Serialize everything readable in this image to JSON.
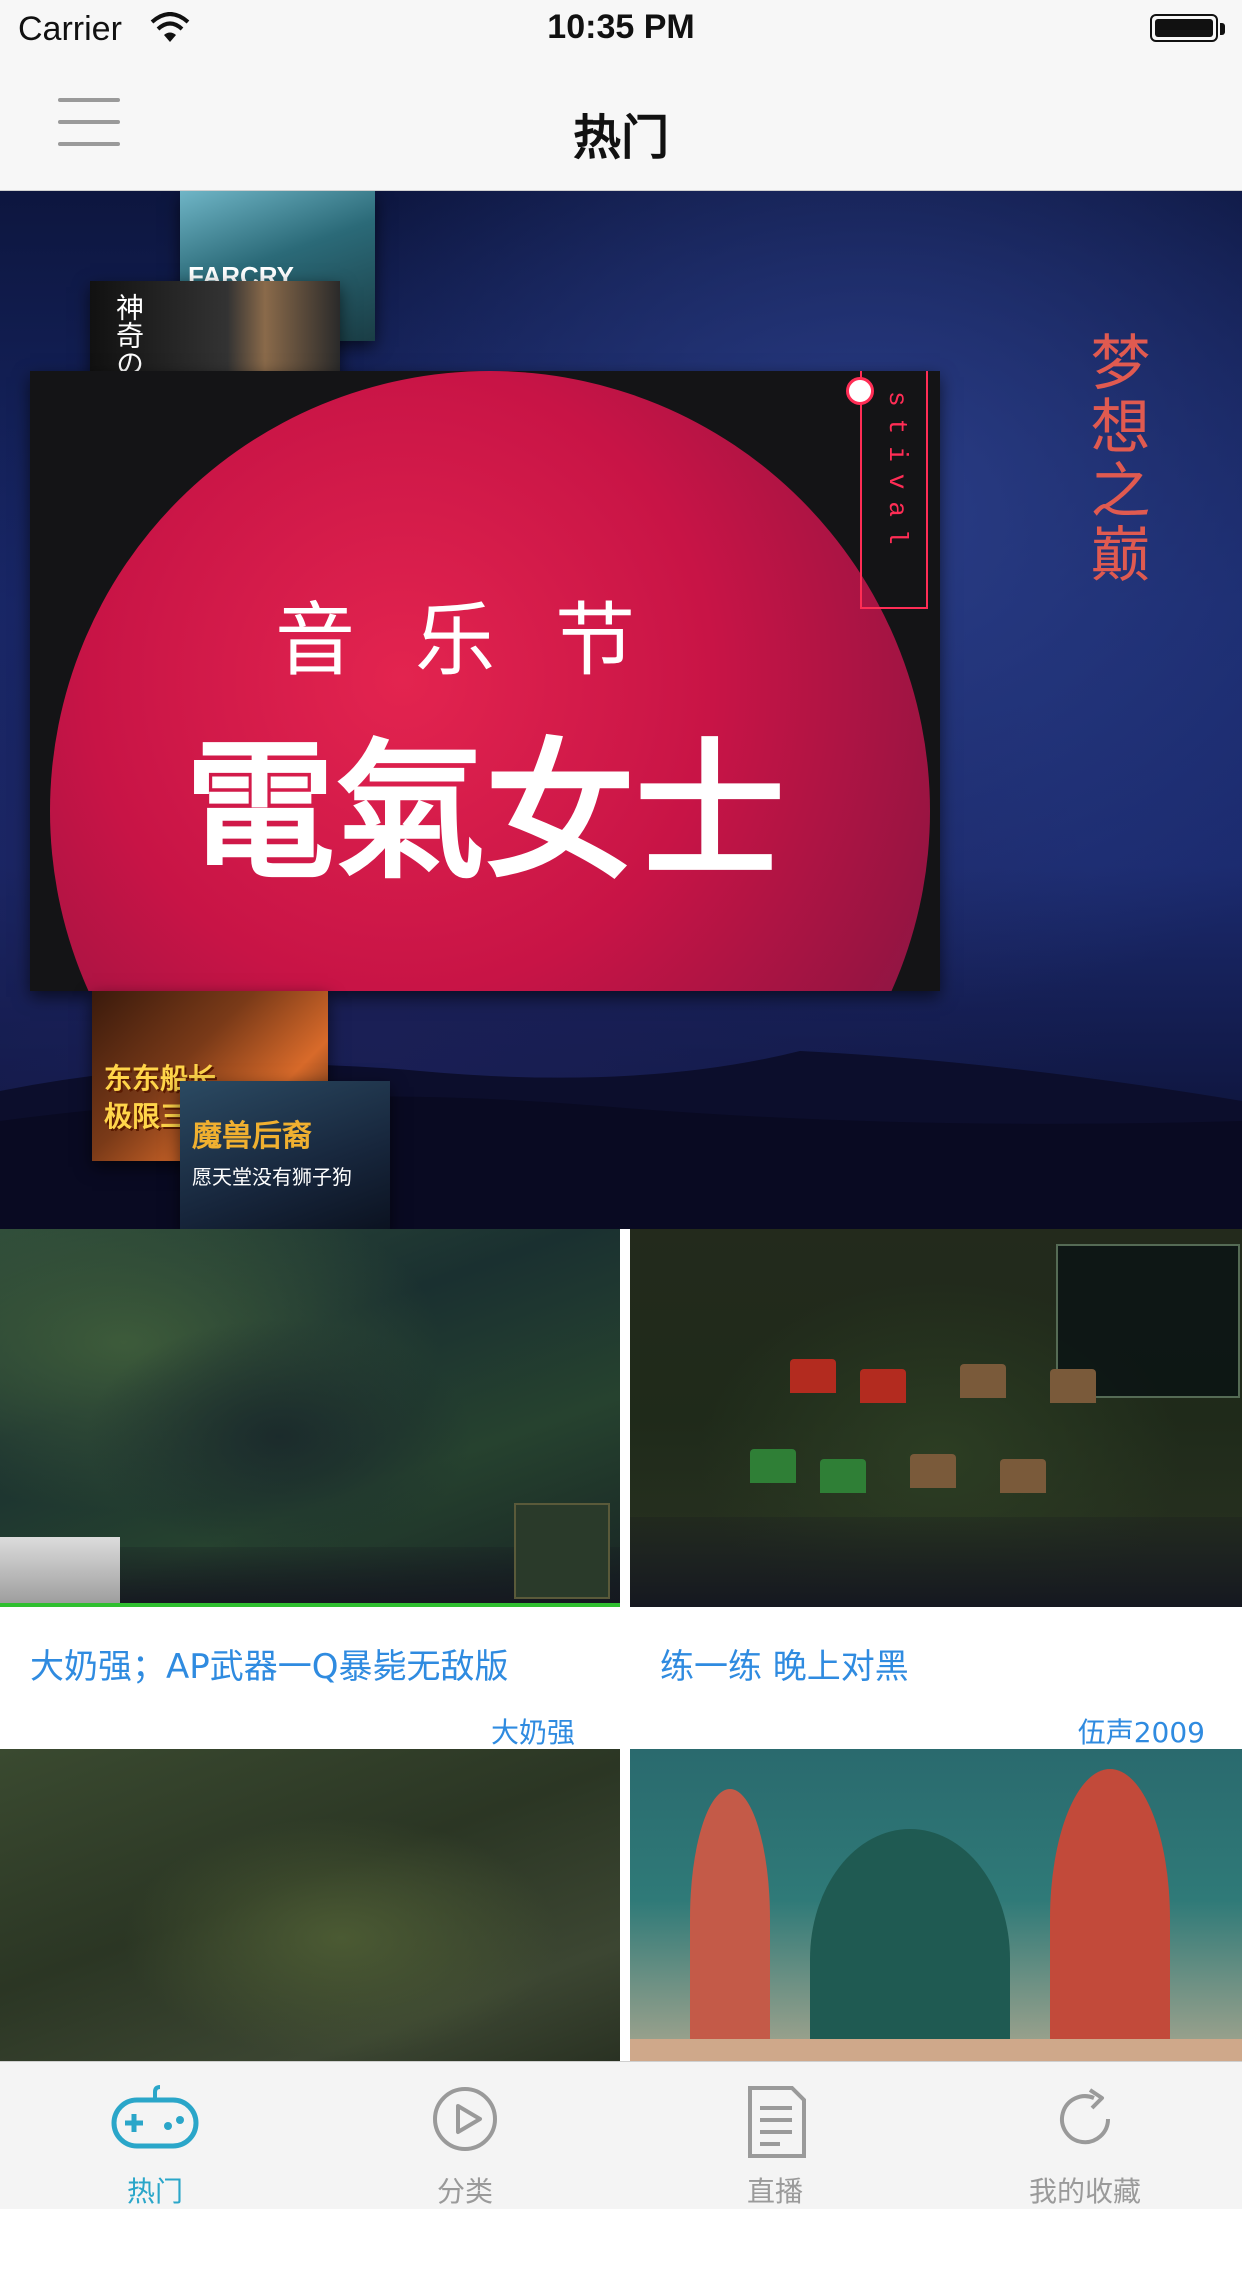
{
  "status_bar": {
    "carrier": "Carrier",
    "time": "10:35 PM"
  },
  "nav": {
    "title": "热门",
    "menu_icon": "hamburger-menu-icon"
  },
  "hero": {
    "side_text": "梦想之巅",
    "slides": {
      "farcry_label": "FARCRY",
      "guitar_label": "神奇の",
      "music_subtitle": "音乐节",
      "music_title": "電氣女士",
      "music_tag": "stival",
      "captain_line1": "东东船长",
      "captain_line2": "极限三连桶",
      "warcraft_line1": "魔兽后裔",
      "warcraft_line2": "愿天堂没有狮子狗"
    }
  },
  "grid": [
    {
      "title": "大奶强；AP武器一Q暴毙无敌版",
      "author": "大奶强"
    },
    {
      "title": "练一练 晚上对黑",
      "author": "伍声2009"
    },
    {
      "title": "",
      "author": ""
    },
    {
      "title": "",
      "author": ""
    }
  ],
  "tab_bar": {
    "active_color": "#2aa6c9",
    "inactive_color": "#9a9a9a",
    "tabs": [
      {
        "label": "热门",
        "icon": "gamepad-icon",
        "active": true
      },
      {
        "label": "分类",
        "icon": "play-circle-icon",
        "active": false
      },
      {
        "label": "直播",
        "icon": "document-icon",
        "active": false
      },
      {
        "label": "我的收藏",
        "icon": "refresh-icon",
        "active": false
      }
    ]
  }
}
